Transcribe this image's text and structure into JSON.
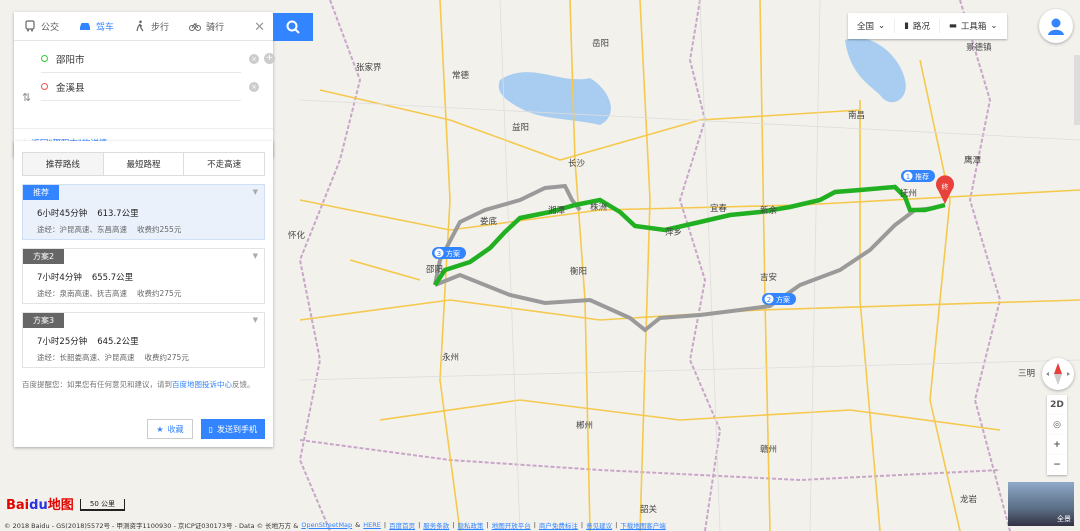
{
  "modes": [
    {
      "label": "公交",
      "icon": "bus-icon"
    },
    {
      "label": "驾车",
      "icon": "car-icon",
      "active": true
    },
    {
      "label": "步行",
      "icon": "walk-icon"
    },
    {
      "label": "骑行",
      "icon": "bike-icon"
    }
  ],
  "search": {
    "start": "邵阳市",
    "end": "金溪县",
    "back": "返回\"邵阳市\"的详情"
  },
  "route_tabs": [
    "推荐路线",
    "最短路程",
    "不走高速"
  ],
  "plans": [
    {
      "tag": "推荐",
      "time": "6小时45分钟",
      "dist": "613.7公里",
      "via": "途经：沪昆高速、东昌高速",
      "fee": "收费约255元"
    },
    {
      "tag": "方案2",
      "time": "7小时4分钟",
      "dist": "655.7公里",
      "via": "途经：泉南高速、抚吉高速",
      "fee": "收费约275元"
    },
    {
      "tag": "方案3",
      "time": "7小时25分钟",
      "dist": "645.2公里",
      "via": "途经：长韶娄高速、沪昆高速",
      "fee": "收费约275元"
    }
  ],
  "tip": {
    "pre": "百度提醒您：如果您有任何意见和建议，请到",
    "link": "百度地图投诉中心",
    "post": "反馈。"
  },
  "buttons": {
    "fav": "收藏",
    "send": "发送到手机"
  },
  "toolbar": {
    "country": "全国",
    "traffic": "路况",
    "tools": "工具箱"
  },
  "controls": {
    "d2": "2D",
    "plus": "+",
    "minus": "−"
  },
  "pano_label": "全景",
  "map": {
    "cities": [
      "南昌",
      "长沙",
      "岳阳",
      "常德",
      "益阳",
      "湘潭",
      "株洲",
      "衡阳",
      "邵阳",
      "永州",
      "郴州",
      "怀化",
      "娄底",
      "宜春",
      "新余",
      "萍乡",
      "吉安",
      "赣州",
      "抚州",
      "鹰潭",
      "景德镇",
      "张家界",
      "三明",
      "龙岩",
      "韶关"
    ],
    "route_labels": [
      {
        "label": "推荐",
        "num": "1"
      },
      {
        "label": "方案",
        "num": "2"
      },
      {
        "label": "方案",
        "num": "3"
      }
    ],
    "end_marker": "终"
  },
  "footer": {
    "copyright": "© 2018 Baidu - GS(2018)5572号 - 甲测资字1100930 - 京ICP证030173号 - Data © 长地万方 &",
    "links": [
      "OpenStreetMap",
      "HERE",
      "百度首页",
      "服务条款",
      "隐私政策",
      "地图开放平台",
      "商户免费标注",
      "意见建议",
      "下载地图客户端"
    ]
  },
  "scale": "50 公里",
  "logo": {
    "bai": "Bai",
    "du": "du",
    "map": "地图"
  },
  "colors": {
    "accent": "#3385ff",
    "route_main": "#21b021",
    "route_alt": "#9a9a9a",
    "end_marker": "#e8403a"
  }
}
